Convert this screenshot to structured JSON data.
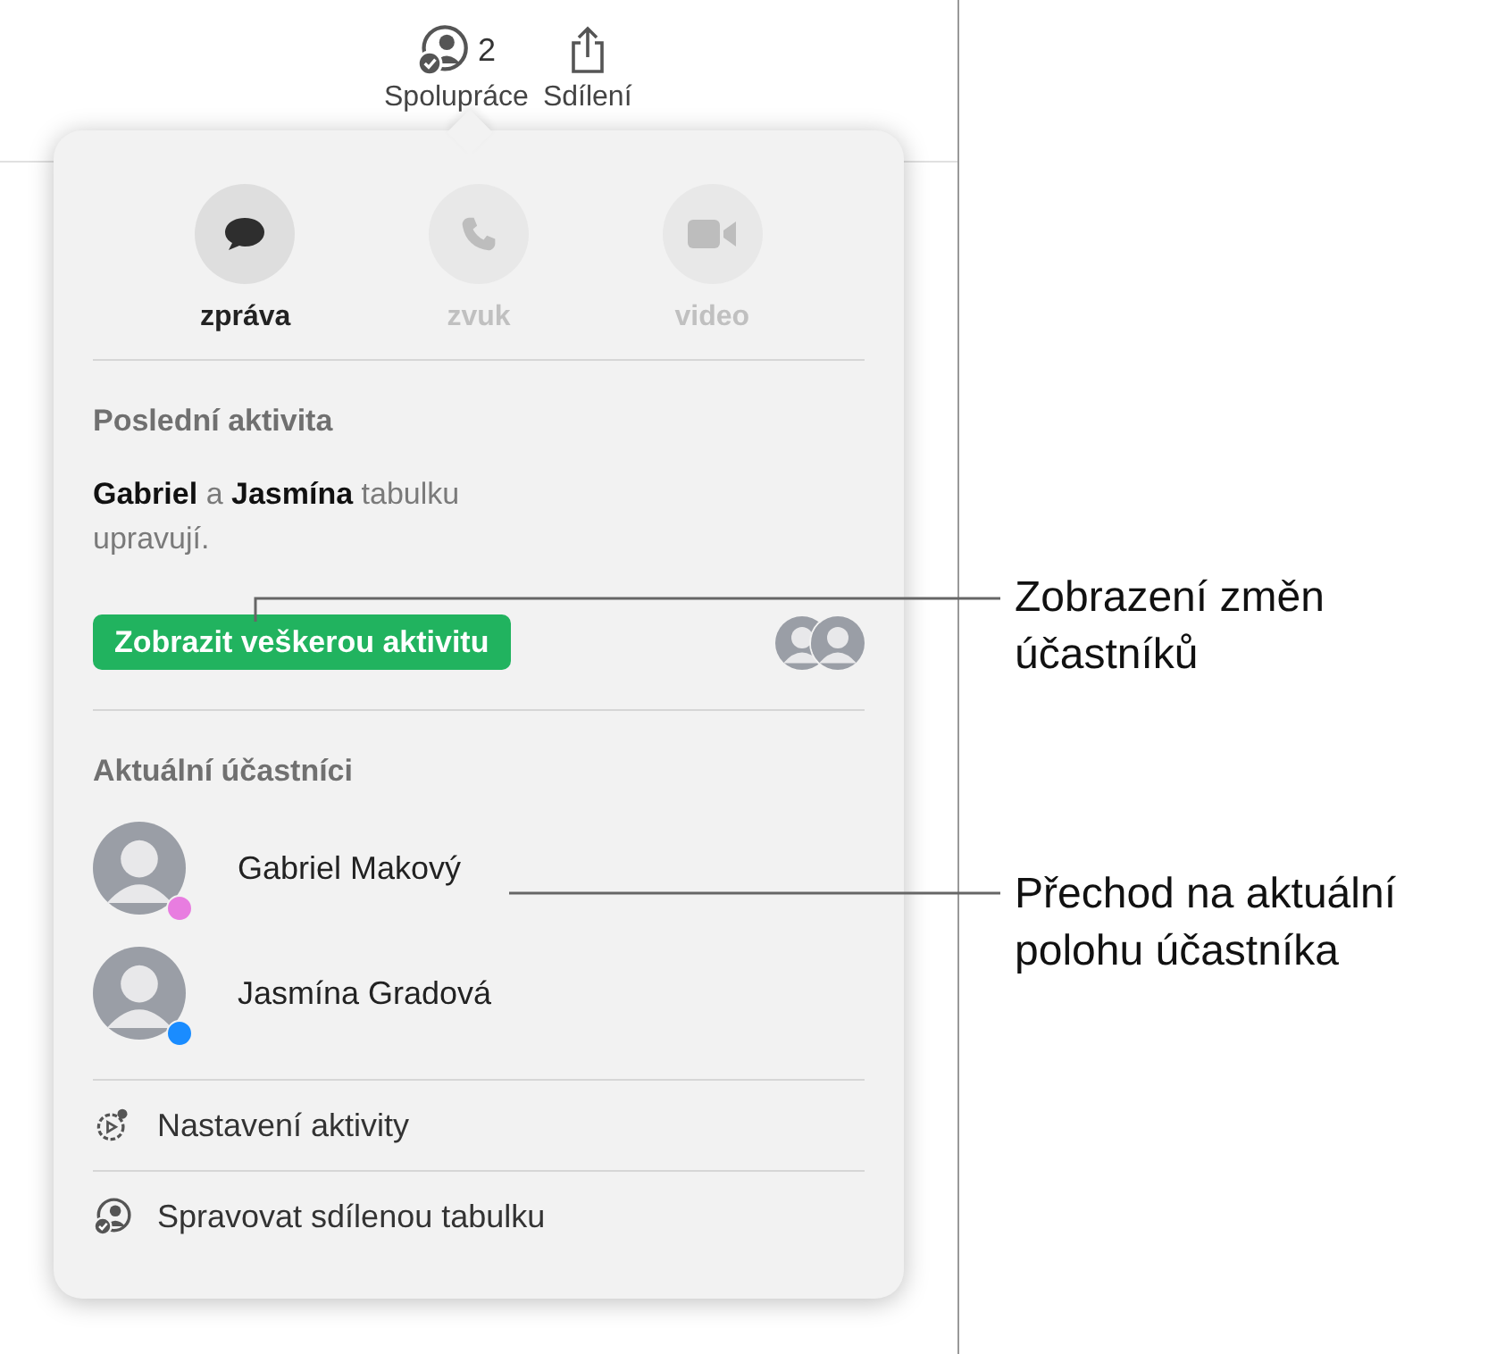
{
  "toolbar": {
    "items": [
      {
        "kind": "collaborate",
        "label": "Spolupráce",
        "count": "2"
      },
      {
        "kind": "share",
        "label": "Sdílení"
      }
    ]
  },
  "popover": {
    "actions": [
      {
        "kind": "message",
        "label": "zpráva",
        "disabled": false
      },
      {
        "kind": "audio",
        "label": "zvuk",
        "disabled": true
      },
      {
        "kind": "video",
        "label": "video",
        "disabled": true
      }
    ],
    "recent_activity": {
      "heading": "Poslední aktivita",
      "summary": "**Gabriel** a **Jasmína** tabulku upravují.",
      "button": "Zobrazit veškerou aktivitu"
    },
    "participants": {
      "heading": "Aktuální účastníci",
      "items": [
        {
          "name": "Gabriel Makový",
          "color": "#e87de0"
        },
        {
          "name": "Jasmína Gradová",
          "color": "#1a8cff"
        }
      ]
    },
    "menu": [
      {
        "kind": "settings",
        "label": "Nastavení aktivity"
      },
      {
        "kind": "manage",
        "label": "Spravovat sdílenou tabulku"
      }
    ]
  },
  "callouts": [
    {
      "text": "Zobrazení změn účastníků"
    },
    {
      "text": "Přechod na aktuální polohu účastníka"
    }
  ]
}
